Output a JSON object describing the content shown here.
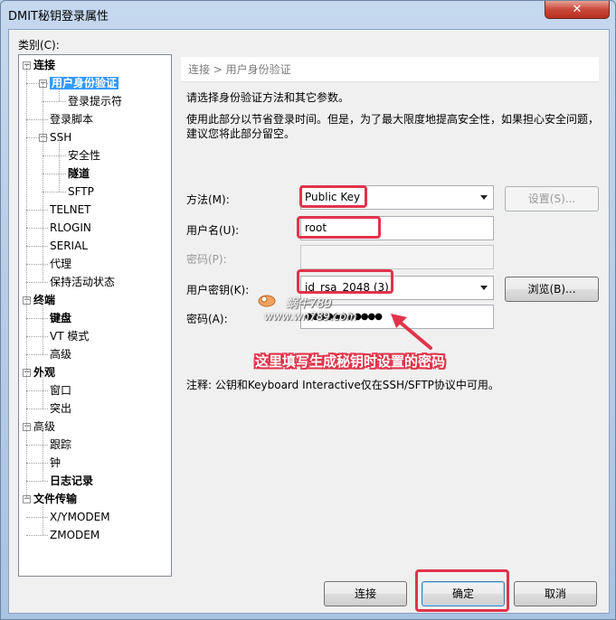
{
  "window": {
    "title": "DMIT秘钥登录属性",
    "close_symbol": "✕"
  },
  "category_label": "类别(C):",
  "tree": [
    {
      "label": "连接",
      "level": 0,
      "expander": "−",
      "bold": true
    },
    {
      "label": "用户身份验证",
      "level": 1,
      "expander": "−",
      "bold": true,
      "selected": true
    },
    {
      "label": "登录提示符",
      "level": 2
    },
    {
      "label": "登录脚本",
      "level": 1
    },
    {
      "label": "SSH",
      "level": 1,
      "expander": "−"
    },
    {
      "label": "安全性",
      "level": 2
    },
    {
      "label": "隧道",
      "level": 2,
      "bold": true
    },
    {
      "label": "SFTP",
      "level": 2
    },
    {
      "label": "TELNET",
      "level": 1
    },
    {
      "label": "RLOGIN",
      "level": 1
    },
    {
      "label": "SERIAL",
      "level": 1
    },
    {
      "label": "代理",
      "level": 1
    },
    {
      "label": "保持活动状态",
      "level": 1
    },
    {
      "label": "终端",
      "level": 0,
      "expander": "−",
      "bold": true
    },
    {
      "label": "键盘",
      "level": 1,
      "bold": true
    },
    {
      "label": "VT 模式",
      "level": 1
    },
    {
      "label": "高级",
      "level": 1
    },
    {
      "label": "外观",
      "level": 0,
      "expander": "−",
      "bold": true
    },
    {
      "label": "窗口",
      "level": 1
    },
    {
      "label": "突出",
      "level": 1
    },
    {
      "label": "高级",
      "level": 0,
      "expander": "−"
    },
    {
      "label": "跟踪",
      "level": 1
    },
    {
      "label": "钟",
      "level": 1
    },
    {
      "label": "日志记录",
      "level": 1,
      "bold": true
    },
    {
      "label": "文件传输",
      "level": 0,
      "expander": "−",
      "bold": true
    },
    {
      "label": "X/YMODEM",
      "level": 1
    },
    {
      "label": "ZMODEM",
      "level": 1
    }
  ],
  "breadcrumb": "连接 > 用户身份验证",
  "intro": "请选择身份验证方法和其它参数。",
  "description_line1": "使用此部分以节省登录时间。但是，为了最大限度地提高安全性，如果担心安全问题，",
  "description_line2": "建议您将此部分留空。",
  "form": {
    "method_label": "方法(M):",
    "method_value": "Public Key",
    "settings_button": "设置(S)...",
    "username_label": "用户名(U):",
    "username_value": "root",
    "password_label": "密码(P):",
    "password_value": "",
    "userkey_label": "用户密钥(K):",
    "userkey_value": "id_rsa_2048 (3)",
    "browse_button": "浏览(B)...",
    "passphrase_label": "密码(A):",
    "passphrase_value": "●●●●●●●●●●●"
  },
  "annotation": "这里填写生成秘钥时设置的密码",
  "watermark_line1": "蜗牛789",
  "watermark_line2": "www.wn789.com",
  "note": "注释: 公钥和Keyboard Interactive仅在SSH/SFTP协议中可用。",
  "buttons": {
    "connect": "连接",
    "ok": "确定",
    "cancel": "取消"
  },
  "colors": {
    "highlight": "#e0344a",
    "selection": "#3399ff"
  }
}
